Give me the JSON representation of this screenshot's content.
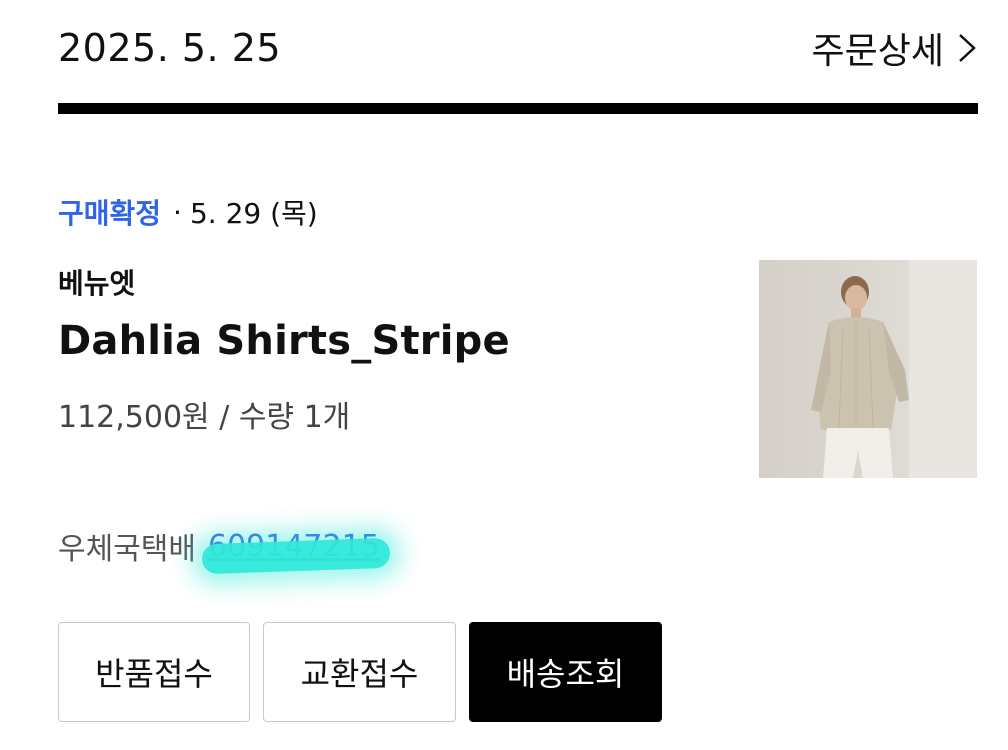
{
  "order": {
    "date": "2025. 5. 25",
    "detail_label": "주문상세"
  },
  "status": {
    "label": "구매확정",
    "separator": "·",
    "date": "5. 29 (목)"
  },
  "product": {
    "brand": "베뉴엣",
    "name": "Dahlia Shirts_Stripe",
    "price_qty": "112,500원 / 수량 1개"
  },
  "shipping": {
    "courier": "우체국택배",
    "tracking_number": "609147215"
  },
  "buttons": {
    "return_label": "반품접수",
    "exchange_label": "교환접수",
    "track_label": "배송조회"
  },
  "colors": {
    "accent": "#2f65e6",
    "redaction": "#2fe8d8"
  }
}
